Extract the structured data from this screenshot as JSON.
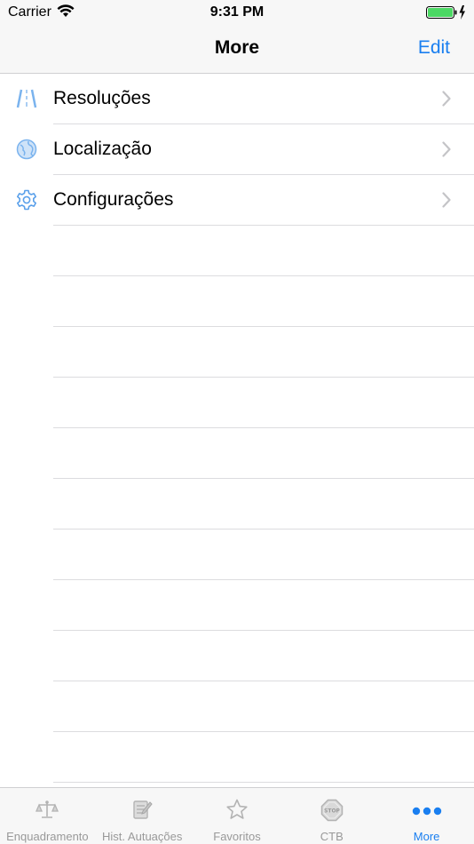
{
  "status_bar": {
    "carrier": "Carrier",
    "time": "9:31 PM"
  },
  "nav": {
    "title": "More",
    "edit_label": "Edit"
  },
  "list": {
    "items": [
      {
        "label": "Resoluções",
        "icon": "road-icon"
      },
      {
        "label": "Localização",
        "icon": "globe-icon"
      },
      {
        "label": "Configurações",
        "icon": "gear-icon"
      }
    ]
  },
  "tabs": [
    {
      "label": "Enquadramento",
      "icon": "scales-icon"
    },
    {
      "label": "Hist. Autuações",
      "icon": "notepad-icon"
    },
    {
      "label": "Favoritos",
      "icon": "star-icon"
    },
    {
      "label": "CTB",
      "icon": "stop-sign-icon"
    },
    {
      "label": "More",
      "icon": "more-dots-icon"
    }
  ],
  "colors": {
    "accent": "#1a7ff0",
    "inactive": "#999999",
    "battery": "#4cd964"
  }
}
